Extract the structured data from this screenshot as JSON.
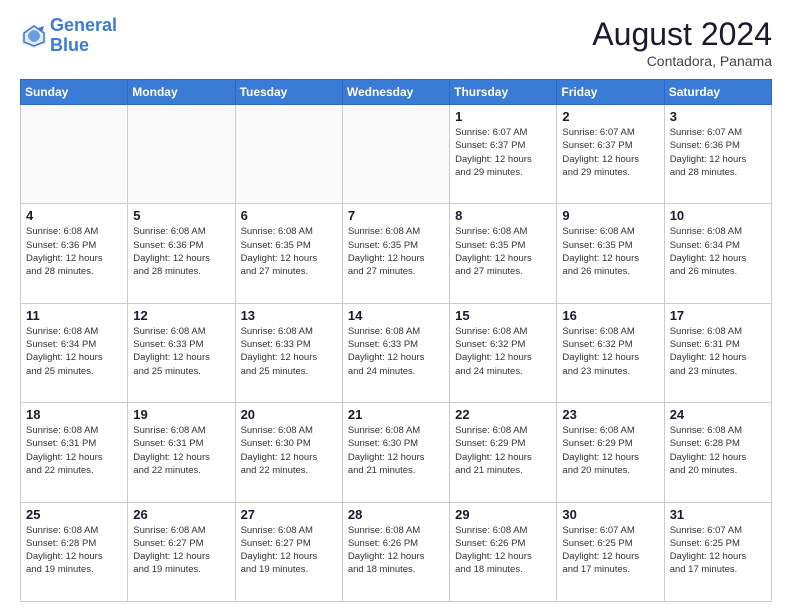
{
  "header": {
    "logo_line1": "General",
    "logo_line2": "Blue",
    "month_year": "August 2024",
    "location": "Contadora, Panama"
  },
  "weekdays": [
    "Sunday",
    "Monday",
    "Tuesday",
    "Wednesday",
    "Thursday",
    "Friday",
    "Saturday"
  ],
  "weeks": [
    [
      {
        "day": "",
        "info": ""
      },
      {
        "day": "",
        "info": ""
      },
      {
        "day": "",
        "info": ""
      },
      {
        "day": "",
        "info": ""
      },
      {
        "day": "1",
        "info": "Sunrise: 6:07 AM\nSunset: 6:37 PM\nDaylight: 12 hours\nand 29 minutes."
      },
      {
        "day": "2",
        "info": "Sunrise: 6:07 AM\nSunset: 6:37 PM\nDaylight: 12 hours\nand 29 minutes."
      },
      {
        "day": "3",
        "info": "Sunrise: 6:07 AM\nSunset: 6:36 PM\nDaylight: 12 hours\nand 28 minutes."
      }
    ],
    [
      {
        "day": "4",
        "info": "Sunrise: 6:08 AM\nSunset: 6:36 PM\nDaylight: 12 hours\nand 28 minutes."
      },
      {
        "day": "5",
        "info": "Sunrise: 6:08 AM\nSunset: 6:36 PM\nDaylight: 12 hours\nand 28 minutes."
      },
      {
        "day": "6",
        "info": "Sunrise: 6:08 AM\nSunset: 6:35 PM\nDaylight: 12 hours\nand 27 minutes."
      },
      {
        "day": "7",
        "info": "Sunrise: 6:08 AM\nSunset: 6:35 PM\nDaylight: 12 hours\nand 27 minutes."
      },
      {
        "day": "8",
        "info": "Sunrise: 6:08 AM\nSunset: 6:35 PM\nDaylight: 12 hours\nand 27 minutes."
      },
      {
        "day": "9",
        "info": "Sunrise: 6:08 AM\nSunset: 6:35 PM\nDaylight: 12 hours\nand 26 minutes."
      },
      {
        "day": "10",
        "info": "Sunrise: 6:08 AM\nSunset: 6:34 PM\nDaylight: 12 hours\nand 26 minutes."
      }
    ],
    [
      {
        "day": "11",
        "info": "Sunrise: 6:08 AM\nSunset: 6:34 PM\nDaylight: 12 hours\nand 25 minutes."
      },
      {
        "day": "12",
        "info": "Sunrise: 6:08 AM\nSunset: 6:33 PM\nDaylight: 12 hours\nand 25 minutes."
      },
      {
        "day": "13",
        "info": "Sunrise: 6:08 AM\nSunset: 6:33 PM\nDaylight: 12 hours\nand 25 minutes."
      },
      {
        "day": "14",
        "info": "Sunrise: 6:08 AM\nSunset: 6:33 PM\nDaylight: 12 hours\nand 24 minutes."
      },
      {
        "day": "15",
        "info": "Sunrise: 6:08 AM\nSunset: 6:32 PM\nDaylight: 12 hours\nand 24 minutes."
      },
      {
        "day": "16",
        "info": "Sunrise: 6:08 AM\nSunset: 6:32 PM\nDaylight: 12 hours\nand 23 minutes."
      },
      {
        "day": "17",
        "info": "Sunrise: 6:08 AM\nSunset: 6:31 PM\nDaylight: 12 hours\nand 23 minutes."
      }
    ],
    [
      {
        "day": "18",
        "info": "Sunrise: 6:08 AM\nSunset: 6:31 PM\nDaylight: 12 hours\nand 22 minutes."
      },
      {
        "day": "19",
        "info": "Sunrise: 6:08 AM\nSunset: 6:31 PM\nDaylight: 12 hours\nand 22 minutes."
      },
      {
        "day": "20",
        "info": "Sunrise: 6:08 AM\nSunset: 6:30 PM\nDaylight: 12 hours\nand 22 minutes."
      },
      {
        "day": "21",
        "info": "Sunrise: 6:08 AM\nSunset: 6:30 PM\nDaylight: 12 hours\nand 21 minutes."
      },
      {
        "day": "22",
        "info": "Sunrise: 6:08 AM\nSunset: 6:29 PM\nDaylight: 12 hours\nand 21 minutes."
      },
      {
        "day": "23",
        "info": "Sunrise: 6:08 AM\nSunset: 6:29 PM\nDaylight: 12 hours\nand 20 minutes."
      },
      {
        "day": "24",
        "info": "Sunrise: 6:08 AM\nSunset: 6:28 PM\nDaylight: 12 hours\nand 20 minutes."
      }
    ],
    [
      {
        "day": "25",
        "info": "Sunrise: 6:08 AM\nSunset: 6:28 PM\nDaylight: 12 hours\nand 19 minutes."
      },
      {
        "day": "26",
        "info": "Sunrise: 6:08 AM\nSunset: 6:27 PM\nDaylight: 12 hours\nand 19 minutes."
      },
      {
        "day": "27",
        "info": "Sunrise: 6:08 AM\nSunset: 6:27 PM\nDaylight: 12 hours\nand 19 minutes."
      },
      {
        "day": "28",
        "info": "Sunrise: 6:08 AM\nSunset: 6:26 PM\nDaylight: 12 hours\nand 18 minutes."
      },
      {
        "day": "29",
        "info": "Sunrise: 6:08 AM\nSunset: 6:26 PM\nDaylight: 12 hours\nand 18 minutes."
      },
      {
        "day": "30",
        "info": "Sunrise: 6:07 AM\nSunset: 6:25 PM\nDaylight: 12 hours\nand 17 minutes."
      },
      {
        "day": "31",
        "info": "Sunrise: 6:07 AM\nSunset: 6:25 PM\nDaylight: 12 hours\nand 17 minutes."
      }
    ]
  ]
}
